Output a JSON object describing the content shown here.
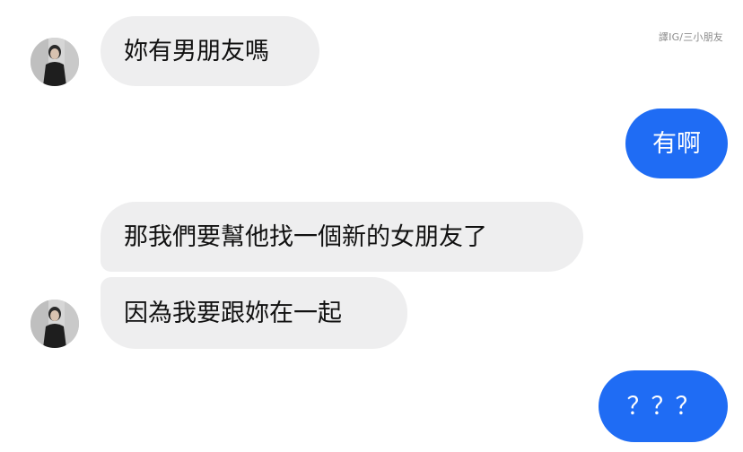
{
  "watermark": "譯IG/三小朋友",
  "messages": [
    {
      "sender": "other",
      "text": "妳有男朋友嗎"
    },
    {
      "sender": "me",
      "text": "有啊"
    },
    {
      "sender": "other",
      "text": "那我們要幫他找一個新的女朋友了"
    },
    {
      "sender": "other",
      "text": "因為我要跟妳在一起"
    },
    {
      "sender": "me",
      "text": "？？？"
    }
  ],
  "avatar_icon": "profile-photo",
  "colors": {
    "incoming_bubble": "#eeeeef",
    "outgoing_bubble": "#1f6cf4",
    "background": "#ffffff"
  }
}
